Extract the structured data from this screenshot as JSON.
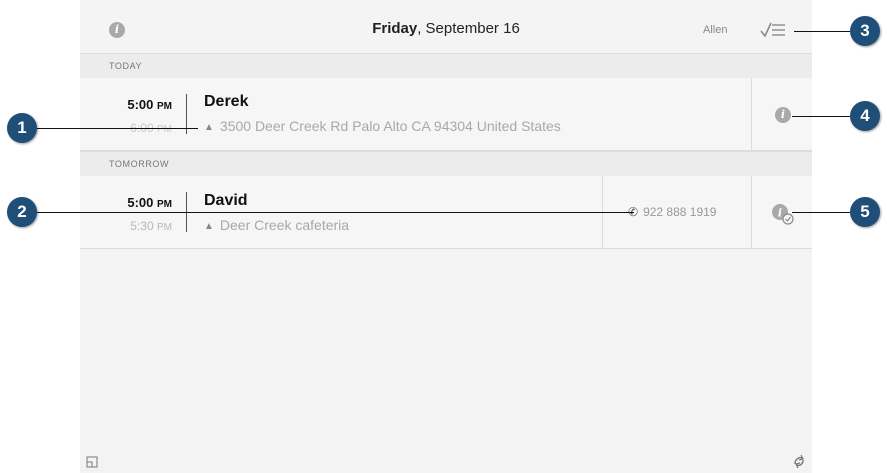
{
  "header": {
    "info_icon": "info-icon",
    "day": "Friday",
    "date": ", September 16",
    "user": "Allen",
    "checklist_icon": "checklist-icon"
  },
  "sections": [
    {
      "label": "TODAY",
      "events": [
        {
          "start_time": "5:00",
          "start_ampm": "PM",
          "end_time": "6:00",
          "end_ampm": "PM",
          "name": "Derek",
          "location": "3500 Deer Creek Rd Palo Alto CA 94304 United States",
          "action_icon": "info-icon"
        }
      ]
    },
    {
      "label": "TOMORROW",
      "events": [
        {
          "start_time": "5:00",
          "start_ampm": "PM",
          "end_time": "5:30",
          "end_ampm": "PM",
          "name": "David",
          "location": "Deer Creek cafeteria",
          "phone": "922 888 1919",
          "action_icon": "info-checked-icon"
        }
      ]
    }
  ],
  "footer": {
    "left_icon": "screen-icon",
    "right_icon": "sync-icon"
  },
  "callouts": [
    "1",
    "2",
    "3",
    "4",
    "5"
  ],
  "colors": {
    "callout": "#1f4e79",
    "background": "#f3f3f3"
  }
}
